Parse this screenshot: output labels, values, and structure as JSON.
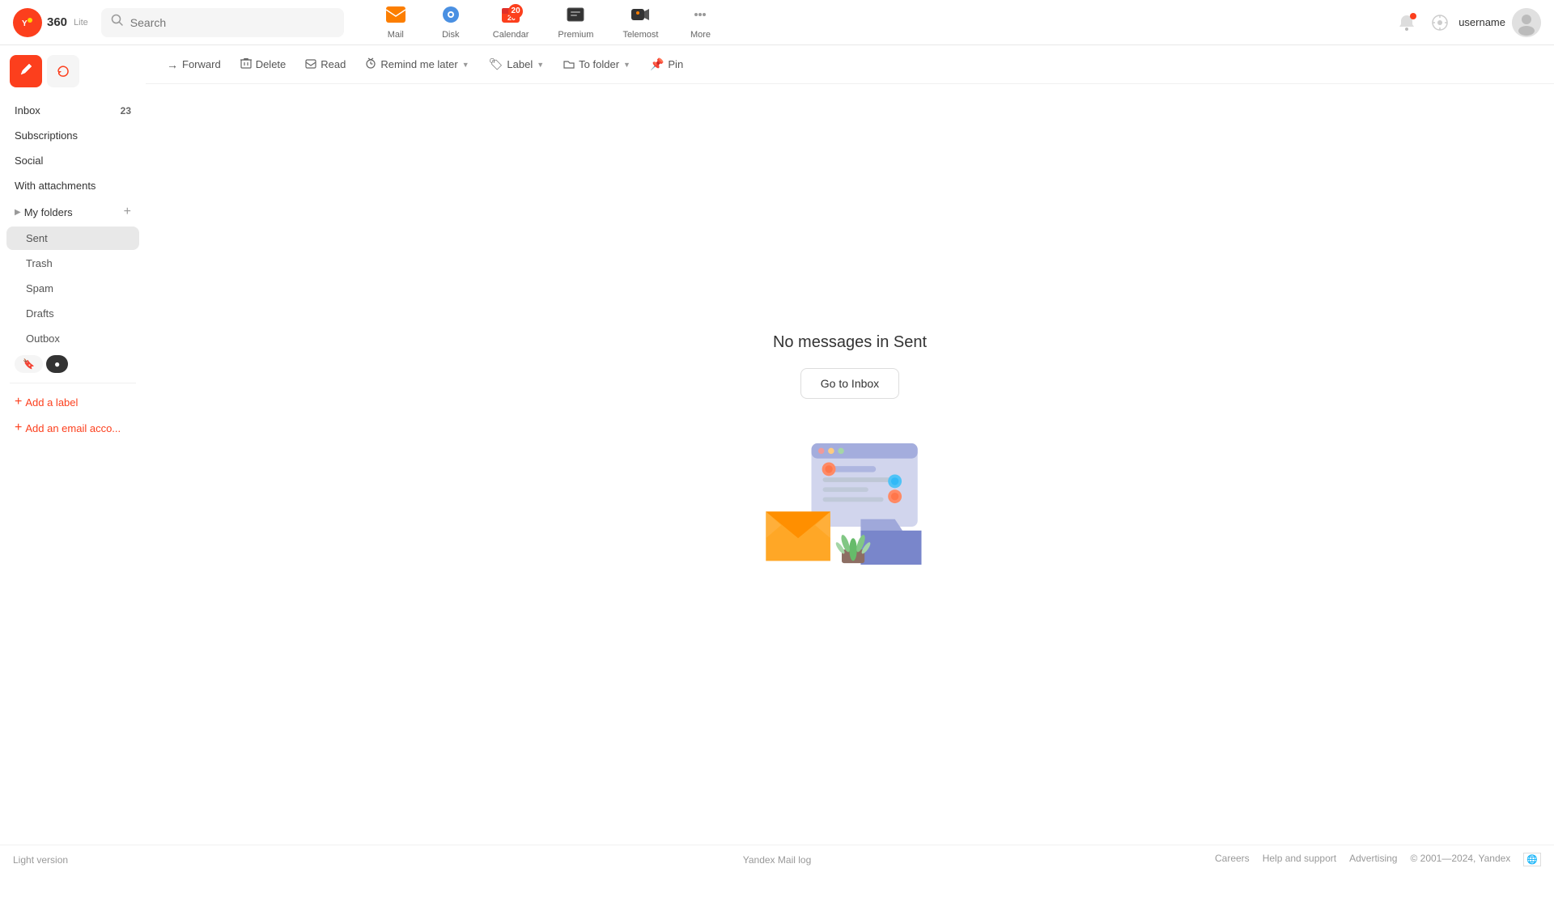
{
  "header": {
    "logo_text": "360",
    "logo_lite": "Lite",
    "search_placeholder": "Search",
    "nav_items": [
      {
        "id": "mail",
        "label": "Mail",
        "icon": "✉",
        "active": true,
        "badge": null
      },
      {
        "id": "disk",
        "label": "Disk",
        "icon": "💾",
        "active": false,
        "badge": null
      },
      {
        "id": "calendar",
        "label": "Calendar",
        "icon": "📅",
        "active": false,
        "badge": "20"
      },
      {
        "id": "premium",
        "label": "Premium",
        "icon": "⬛",
        "active": false,
        "badge": null
      },
      {
        "id": "telemost",
        "label": "Telemost",
        "icon": "📹",
        "active": false,
        "badge": null
      },
      {
        "id": "more",
        "label": "More",
        "icon": "•••",
        "active": false,
        "badge": null
      }
    ]
  },
  "sidebar": {
    "compose_label": "Compose",
    "refresh_label": "Refresh",
    "items": [
      {
        "id": "inbox",
        "label": "Inbox",
        "count": "23",
        "active": false,
        "sub": false
      },
      {
        "id": "subscriptions",
        "label": "Subscriptions",
        "count": null,
        "active": false,
        "sub": false
      },
      {
        "id": "social",
        "label": "Social",
        "count": null,
        "active": false,
        "sub": false
      },
      {
        "id": "with-attachments",
        "label": "With attachments",
        "count": null,
        "active": false,
        "sub": false
      }
    ],
    "my_folders_label": "My folders",
    "add_folder_icon": "+",
    "sub_items": [
      {
        "id": "sent",
        "label": "Sent",
        "active": true
      },
      {
        "id": "trash",
        "label": "Trash",
        "active": false
      },
      {
        "id": "spam",
        "label": "Spam",
        "active": false
      },
      {
        "id": "drafts",
        "label": "Drafts",
        "active": false
      },
      {
        "id": "outbox",
        "label": "Outbox",
        "active": false
      }
    ],
    "label_filters": [
      {
        "id": "bookmark",
        "icon": "🔖",
        "active": false
      },
      {
        "id": "dot",
        "icon": "●",
        "active": false
      }
    ],
    "add_label": "Add a label",
    "add_account": "Add an email acco..."
  },
  "toolbar": {
    "buttons": [
      {
        "id": "forward",
        "label": "Forward",
        "icon": "→"
      },
      {
        "id": "delete",
        "label": "Delete",
        "icon": "🗑"
      },
      {
        "id": "read",
        "label": "Read",
        "icon": "✉"
      },
      {
        "id": "remind",
        "label": "Remind me later",
        "icon": "🔔",
        "has_arrow": true
      },
      {
        "id": "label",
        "label": "Label",
        "icon": "🏷",
        "has_arrow": true
      },
      {
        "id": "to-folder",
        "label": "To folder",
        "icon": "📁",
        "has_arrow": true
      },
      {
        "id": "pin",
        "label": "Pin",
        "icon": "📌"
      }
    ]
  },
  "main": {
    "empty_title": "No messages in Sent",
    "go_inbox_label": "Go to Inbox"
  },
  "footer": {
    "light_version": "Light version",
    "mail_log": "Yandex Mail log",
    "right_links": [
      "Careers",
      "Help and support",
      "Advertising"
    ],
    "copyright": "© 2001—2024, Yandex"
  }
}
